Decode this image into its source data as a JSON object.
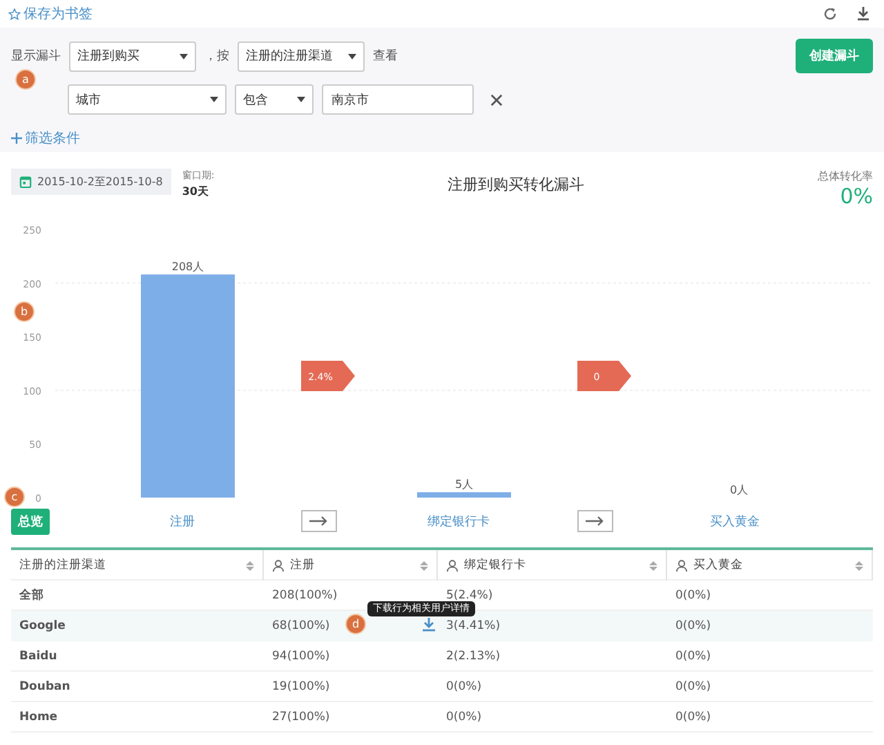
{
  "toolbar": {
    "bookmark": "保存为书签"
  },
  "query": {
    "label": "显示漏斗",
    "funnel": "注册到购买",
    "by": "，按",
    "group": "注册的注册渠道",
    "view": "查看",
    "create_button": "创建漏斗"
  },
  "filters": [
    {
      "field": "城市",
      "operator": "包含",
      "value": "南京市"
    }
  ],
  "add_filter": "筛选条件",
  "chart_header": {
    "date_range": "2015-10-2至2015-10-8",
    "window_label": "窗口期:",
    "window_value": "30天",
    "title": "注册到购买转化漏斗",
    "total_label": "总体转化率",
    "total_value": "0%"
  },
  "chart_data": {
    "type": "bar",
    "categories": [
      "注册",
      "绑定银行卡",
      "买入黄金"
    ],
    "values": [
      208,
      5,
      0
    ],
    "ylim": [
      0,
      250
    ],
    "yticks": [
      0,
      50,
      100,
      150,
      200,
      250
    ],
    "value_labels": [
      "208人",
      "5人",
      "0人"
    ]
  },
  "conversions": [
    "2.4%",
    "0"
  ],
  "overview_button": "总览",
  "markers": [
    "a",
    "b",
    "c",
    "d"
  ],
  "table": {
    "columns": [
      {
        "label": "注册的注册渠道",
        "user_icon": false
      },
      {
        "label": "注册",
        "user_icon": true
      },
      {
        "label": "绑定银行卡",
        "user_icon": true
      },
      {
        "label": "买入黄金",
        "user_icon": true
      }
    ],
    "rows": [
      {
        "cells": [
          "全部",
          "208(100%)",
          "5(2.4%)",
          "0(0%)"
        ],
        "highlighted": false,
        "tooltip": ""
      },
      {
        "cells": [
          "Google",
          "68(100%)",
          "3(4.41%)",
          "0(0%)"
        ],
        "highlighted": true,
        "tooltip": "下载行为相关用户详情"
      },
      {
        "cells": [
          "Baidu",
          "94(100%)",
          "2(2.13%)",
          "0(0%)"
        ],
        "highlighted": false,
        "tooltip": ""
      },
      {
        "cells": [
          "Douban",
          "19(100%)",
          "0(0%)",
          "0(0%)"
        ],
        "highlighted": false,
        "tooltip": ""
      },
      {
        "cells": [
          "Home",
          "27(100%)",
          "0(0%)",
          "0(0%)"
        ],
        "highlighted": false,
        "tooltip": ""
      }
    ]
  }
}
